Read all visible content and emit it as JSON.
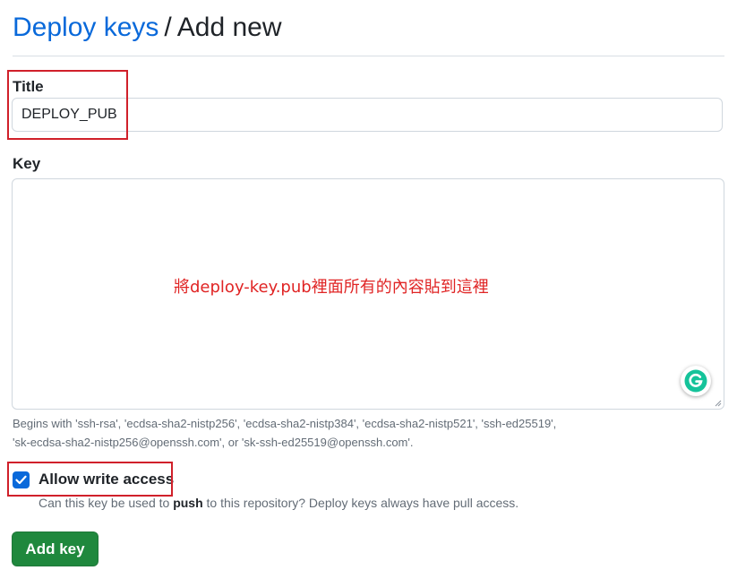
{
  "breadcrumb": {
    "link_label": "Deploy keys",
    "separator": "/",
    "current": "Add new"
  },
  "title_field": {
    "label": "Title",
    "value": "DEPLOY_PUB"
  },
  "key_field": {
    "label": "Key",
    "value": "",
    "annotation": "將deploy-key.pub裡面所有的內容貼到這裡",
    "hint_line1": "Begins with 'ssh-rsa', 'ecdsa-sha2-nistp256', 'ecdsa-sha2-nistp384', 'ecdsa-sha2-nistp521', 'ssh-ed25519',",
    "hint_line2": "'sk-ecdsa-sha2-nistp256@openssh.com', or 'sk-ssh-ed25519@openssh.com'."
  },
  "write_access": {
    "label": "Allow write access",
    "checked": true,
    "note_prefix": "Can this key be used to ",
    "note_bold": "push",
    "note_suffix": " to this repository? Deploy keys always have pull access."
  },
  "submit": {
    "label": "Add key"
  },
  "icons": {
    "grammarly": "grammarly-icon",
    "checkbox": "checkmark-icon"
  },
  "colors": {
    "link": "#0969da",
    "button": "#1f883d",
    "annotation": "#e02424",
    "highlight": "#d0202a"
  }
}
